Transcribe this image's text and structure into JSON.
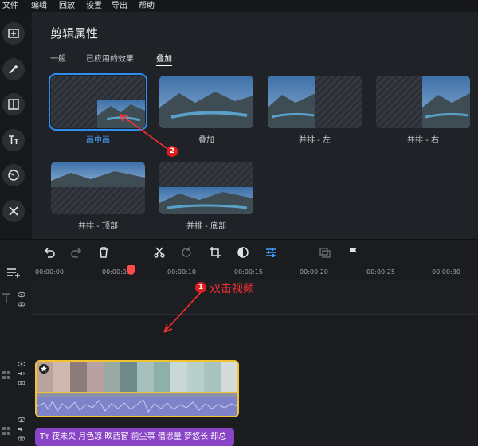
{
  "menu": [
    "文件",
    "编辑",
    "回放",
    "设置",
    "导出",
    "帮助"
  ],
  "panel": {
    "title": "剪辑属性",
    "tabs": [
      "一般",
      "已应用的效果",
      "叠加"
    ],
    "active_tab": 2,
    "options": [
      {
        "label": "画中画",
        "selected": true
      },
      {
        "label": "叠加",
        "selected": false
      },
      {
        "label": "并排 - 左",
        "selected": false
      },
      {
        "label": "并排 - 右",
        "selected": false
      },
      {
        "label": "并排 - 顶部",
        "selected": false
      },
      {
        "label": "并排 - 底部",
        "selected": false
      }
    ]
  },
  "sidebar_icons": [
    "add-media-icon",
    "magic-wand-icon",
    "transition-icon",
    "text-icon",
    "filter-icon",
    "tools-icon"
  ],
  "ruler": [
    "00:00:00",
    "00:00:05",
    "00:00:10",
    "00:00:15",
    "00:00:20",
    "00:00:25",
    "00:00:30"
  ],
  "text_clip": "Tт  夜未央 月色凉 映西窗 前尘事 借思量 梦悠长 却总",
  "annotations": {
    "step1_num": "1",
    "step1_text": "双击视频",
    "step2_num": "2"
  },
  "colors": {
    "accent": "#2f8cf0",
    "clip_border": "#f1c232",
    "playhead": "#ff4b4b",
    "text_clip": "#8a45c7",
    "annotation": "#ff3030"
  }
}
